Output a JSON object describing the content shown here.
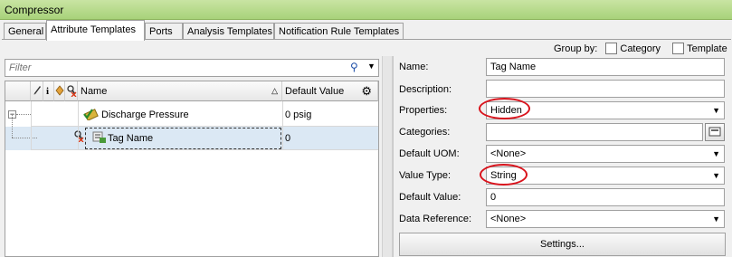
{
  "window": {
    "title": "Compressor"
  },
  "tabs": [
    {
      "label": "General"
    },
    {
      "label": "Attribute Templates"
    },
    {
      "label": "Ports"
    },
    {
      "label": "Analysis Templates"
    },
    {
      "label": "Notification Rule Templates"
    }
  ],
  "group_by": {
    "label": "Group by:",
    "options": [
      "Category",
      "Template"
    ]
  },
  "filter": {
    "placeholder": "Filter"
  },
  "grid": {
    "columns": {
      "name": "Name",
      "default_value": "Default Value"
    },
    "rows": [
      {
        "name": "Discharge Pressure",
        "default_value": "0 psig"
      },
      {
        "name": "Tag Name",
        "default_value": "0"
      }
    ]
  },
  "properties": {
    "name": {
      "label": "Name:",
      "value": "Tag Name"
    },
    "description": {
      "label": "Description:",
      "value": ""
    },
    "properties": {
      "label": "Properties:",
      "value": "Hidden"
    },
    "categories": {
      "label": "Categories:",
      "value": ""
    },
    "default_uom": {
      "label": "Default UOM:",
      "value": "<None>"
    },
    "value_type": {
      "label": "Value Type:",
      "value": "String"
    },
    "default_value": {
      "label": "Default Value:",
      "value": "0"
    },
    "data_reference": {
      "label": "Data Reference:",
      "value": "<None>"
    },
    "settings_button": "Settings..."
  },
  "annotation_color": "#d9131c",
  "theme": {
    "title_green": "#a8d27a",
    "selected_row": "#dbe8f4"
  }
}
